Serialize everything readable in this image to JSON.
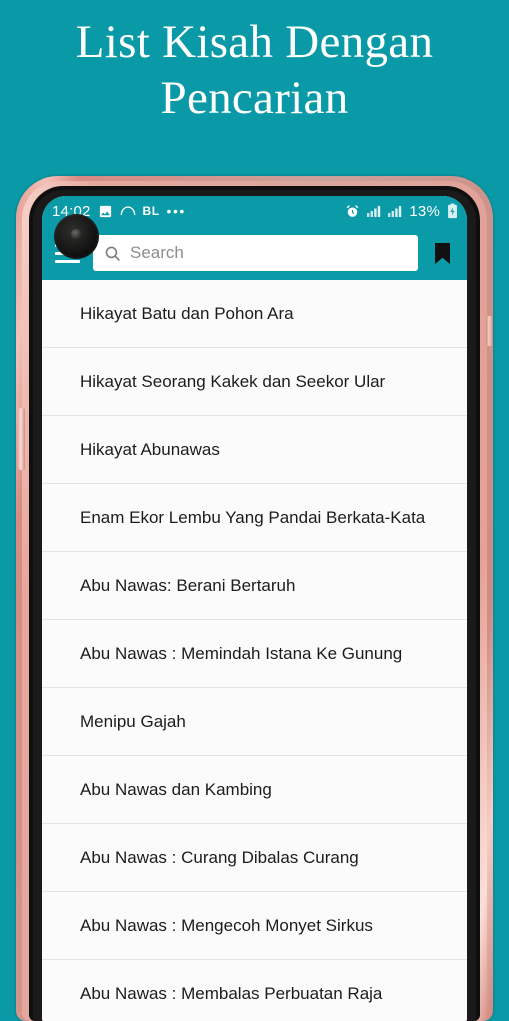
{
  "hero": {
    "title": "List Kisah Dengan Pencarian",
    "background_color": "#0a9aa7",
    "text_color": "#ffffff"
  },
  "statusbar": {
    "time": "14:02",
    "image_icon": "image-icon",
    "cloud_icon": "cloud-icon",
    "carrier": "BL",
    "overflow": "•••",
    "alarm_icon": "alarm-icon",
    "signal_icon_1": "signal-bars-icon",
    "signal_icon_2": "signal-bars-icon",
    "battery_percent": "13%",
    "battery_icon": "battery-charging-icon"
  },
  "appbar": {
    "menu_icon": "hamburger-menu-icon",
    "bookmark_icon": "bookmark-icon",
    "accent_color": "#0b9aa8"
  },
  "search": {
    "icon": "search-icon",
    "value": "",
    "placeholder": "Search"
  },
  "list": {
    "items": [
      {
        "title": "Hikayat Batu dan Pohon Ara"
      },
      {
        "title": "Hikayat Seorang Kakek dan Seekor Ular"
      },
      {
        "title": "Hikayat Abunawas"
      },
      {
        "title": "Enam Ekor Lembu Yang Pandai Berkata-Kata"
      },
      {
        "title": "Abu Nawas: Berani Bertaruh"
      },
      {
        "title": "Abu Nawas : Memindah Istana Ke Gunung"
      },
      {
        "title": "Menipu Gajah"
      },
      {
        "title": "Abu Nawas dan Kambing"
      },
      {
        "title": "Abu Nawas : Curang Dibalas Curang"
      },
      {
        "title": "Abu Nawas : Mengecoh Monyet Sirkus"
      },
      {
        "title": "Abu Nawas : Membalas Perbuatan Raja"
      }
    ]
  }
}
